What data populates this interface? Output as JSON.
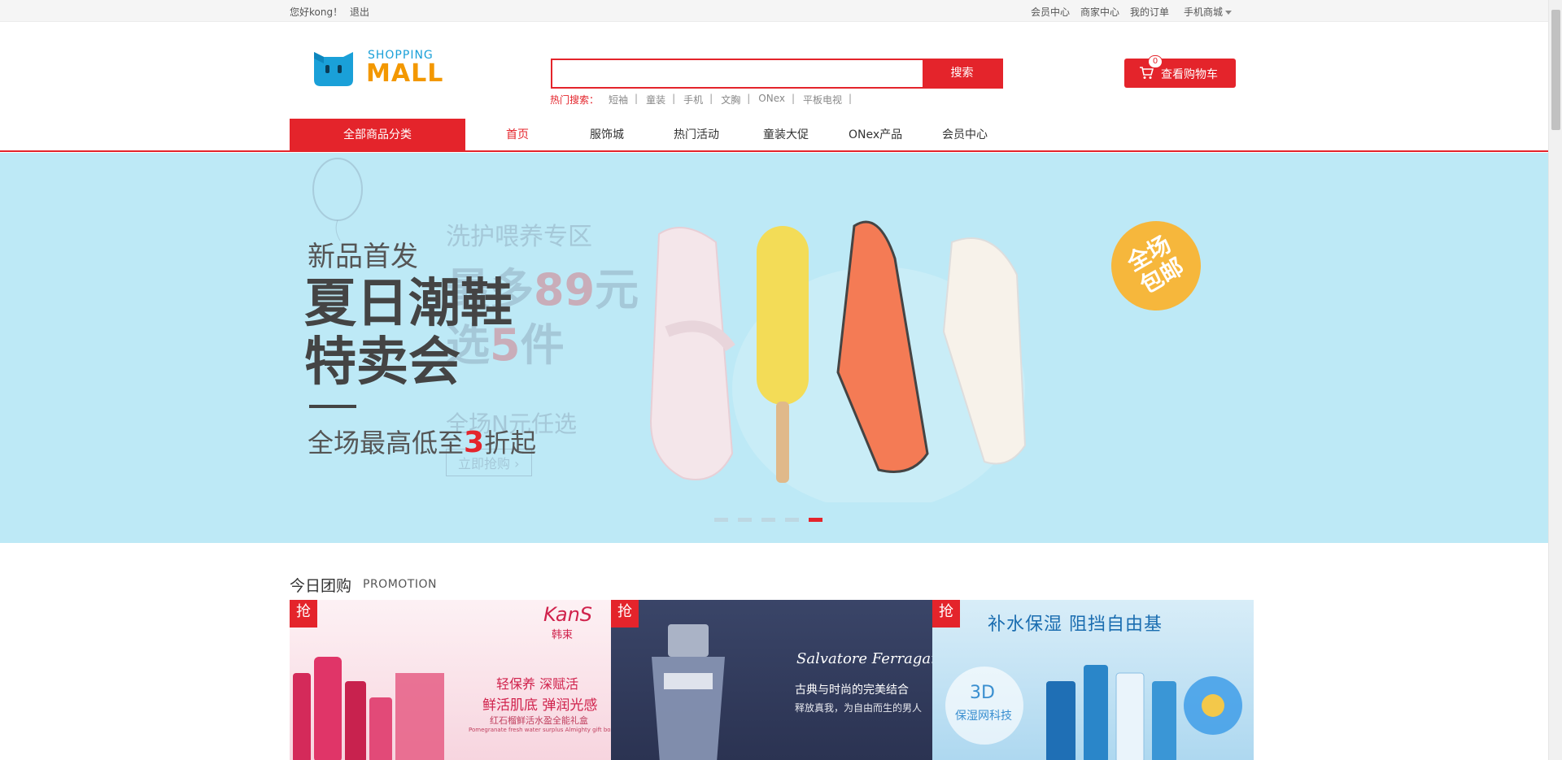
{
  "topbar": {
    "greeting": "您好kong！",
    "logout": "退出",
    "links": [
      "会员中心",
      "商家中心",
      "我的订单",
      "手机商城"
    ]
  },
  "logo": {
    "shopping": "SHOPPING",
    "mall": "MALL"
  },
  "search": {
    "placeholder": "",
    "button": "搜索",
    "hot_label": "热门搜索：",
    "hot_keywords": [
      "短袖",
      "童装",
      "手机",
      "文胸",
      "ONex",
      "平板电视"
    ],
    "separator": "|"
  },
  "cart": {
    "label": "查看购物车",
    "count": "0"
  },
  "nav": {
    "all_categories": "全部商品分类",
    "items": [
      "首页",
      "服饰城",
      "热门活动",
      "童装大促",
      "ONex产品",
      "会员中心"
    ]
  },
  "banner": {
    "subtitle": "新品首发",
    "title_line1": "夏日潮鞋",
    "title_line2": "特卖会",
    "desc_prefix": "全场最高低至",
    "desc_num": "3",
    "desc_suffix": "折起",
    "badge_line1": "全场",
    "badge_line2": "包邮",
    "ghost": {
      "zone": "洗护喂养专区",
      "max1": "最多",
      "max_num": "89",
      "max2": "元",
      "pick1": "选",
      "pick_num": "5",
      "pick2": "件",
      "any": "全场N元任选",
      "buy": "立即抢购 ›"
    },
    "slides_total": 5,
    "active_slide": 5
  },
  "promotion": {
    "title": "今日团购",
    "subtitle": "PROMOTION",
    "tag": "抢",
    "cards": [
      {
        "brand": "KanS",
        "brand_cn": "韩束",
        "line1": "轻保养 深赋活",
        "line2": "鲜活肌底 弹润光感",
        "line3": "红石榴鲜活水盈全能礼盒",
        "line4": "Pomegranate fresh water surplus Almighty gift box"
      },
      {
        "brand": "Salvatore Ferragamo",
        "line1": "古典与时尚的完美结合",
        "line2": "释放真我，为自由而生的男人"
      },
      {
        "headline": "补水保湿 阻挡自由基",
        "bubble_big": "3D",
        "bubble_small": "保湿网科技"
      }
    ]
  },
  "colors": {
    "accent": "#e4242b",
    "banner_bg": "#bde9f6",
    "logo_blue": "#1aa0d8",
    "logo_orange": "#f39800"
  }
}
